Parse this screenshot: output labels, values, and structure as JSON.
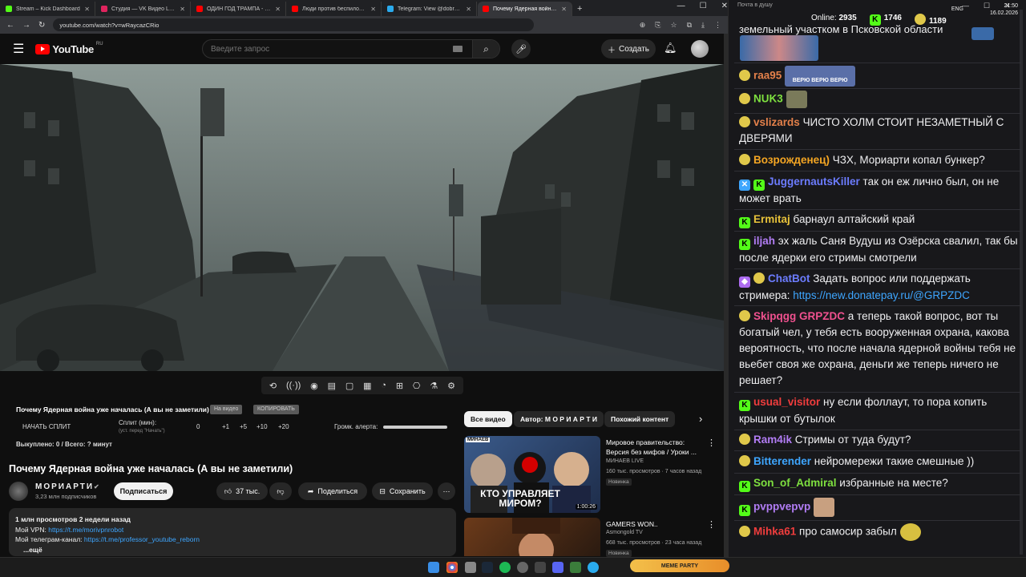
{
  "browser": {
    "tabs": [
      {
        "title": "Stream – Kick Dashboard",
        "color": "#53fc18",
        "active": false
      },
      {
        "title": "Студия — VK Видео Live",
        "color": "#e0245e",
        "active": false
      },
      {
        "title": "ОДИН ГОД ТРАМПА - YouTub...",
        "color": "#ff0000",
        "active": false
      },
      {
        "title": "Люди против беспилодни: сем...",
        "color": "#ff0000",
        "active": false
      },
      {
        "title": "Telegram: View @dobro_2ch",
        "color": "#2aabee",
        "active": false
      },
      {
        "title": "Почему Ядерная война у...",
        "color": "#ff0000",
        "active": true
      }
    ],
    "url": "youtube.com/watch?v=wRaycazCRio"
  },
  "youtube": {
    "logo_text": "YouTube",
    "region": "RU",
    "search_placeholder": "Введите запрос",
    "create_label": "Создать",
    "split_panel": {
      "title": "Почему Ядерная война уже началась (А вы не заметили)",
      "chip1": "На видео",
      "chip2": "КОПИРОВАТЬ",
      "start_split": "НАЧАТЬ СПЛИТ",
      "split_min": "Сплит (мин):",
      "split_hint": "(уст. перед \"Начать\")",
      "split_value": "0",
      "p1": "+1",
      "p5": "+5",
      "p10": "+10",
      "p20": "+20",
      "alert_label": "Громк. алерта:",
      "alert_volume": 1.0,
      "bought": "Выкуплено: 0 / Всего: ? минут"
    },
    "video_title": "Почему Ядерная война уже началась (А вы не заметили)",
    "channel": {
      "name": "МОРИАРТИ",
      "subs": "3,23 млн подписчиков",
      "subscribe": "Подписаться"
    },
    "actions": {
      "likes": "37 тыс.",
      "share": "Поделиться",
      "save": "Сохранить"
    },
    "description": {
      "stats": "1 млн просмотров  2 недели назад",
      "vpn_label": "Мой VPN: ",
      "vpn_link": "https://t.me/morivpnrobot",
      "tg_label": "Мой телеграм-канал: ",
      "tg_link": "https://t.me/professor_youtube_reborn",
      "more": "...ещё"
    },
    "rec_chips": [
      "Все видео",
      "Автор: М О Р И А Р Т И",
      "Похожий контент"
    ],
    "recommendations": [
      {
        "title": "Мировое правительство: Версия без мифов / Уроки ...",
        "channel": "МИНАЕВ LIVE",
        "meta": "160 тыс. просмотров · 7 часов назад",
        "badge": "Новинка",
        "thumb_text": "КТО УПРАВЛЯЕТ МИРОМ?",
        "thumb_tag": "МИНАЕВ",
        "duration": "1:00:26"
      },
      {
        "title": "GAMERS WON..",
        "channel": "Asmongold TV",
        "meta": "668 тыс. просмотров · 23 часа назад",
        "badge": "Новинка",
        "thumb_text": "",
        "thumb_tag": "",
        "duration": ""
      }
    ]
  },
  "chat": {
    "window_title": "Почта в душу",
    "online_label": "Online:",
    "online": "2935",
    "kick_count": "1746",
    "other_count": "1189",
    "top_text": "земельный участком в Псковской области",
    "messages": [
      {
        "user": "raa95",
        "color": "#e3804a",
        "text": "",
        "badges": [
          "p"
        ],
        "emote": "ВЕРЮ ВЕРЮ ВЕРЮ"
      },
      {
        "user": "NUK3",
        "color": "#7ee03f",
        "text": "",
        "badges": [
          "p"
        ]
      },
      {
        "user": "vslizards",
        "color": "#e3804a",
        "text": "ЧИСТО ХОЛМ СТОИТ НЕЗАМЕТНЫЙ С ДВЕРЯМИ",
        "badges": [
          "p"
        ]
      },
      {
        "user": "Возрожденец)",
        "color": "#f5a623",
        "text": "ЧЗХ, Мориарти копал бункер?",
        "badges": [
          "p"
        ]
      },
      {
        "user": "JuggernautsKiller",
        "color": "#6c7cff",
        "text": "так он еж лично был, он не может врать",
        "badges": [
          "b",
          "k"
        ]
      },
      {
        "user": "Ermitaj",
        "color": "#e8c23a",
        "text": "барнаул алтайский край",
        "badges": [
          "k"
        ]
      },
      {
        "user": "iljah",
        "color": "#b27df5",
        "text": "эх жаль Саня Вудуш из Озёрска свалил, так бы после ядерки его стримы смотрели",
        "badges": [
          "k"
        ]
      },
      {
        "user": "ChatBot",
        "color": "#6c7cff",
        "text": "Задать вопрос или поддержать стримера: ",
        "link": "https://new.donatepay.ru/@GRPZDC",
        "badges": [
          "c",
          "p"
        ]
      },
      {
        "user": "Skipqgg",
        "color": "#f0518f",
        "mention": "GRPZDC",
        "text": "а теперь такой вопрос, вот ты богатый чел, у тебя есть вооруженная охрана, какова вероятность, что после начала ядерной войны тебя не вьебет своя же охрана, деньги же теперь ничего не решает?",
        "badges": [
          "p"
        ]
      },
      {
        "user": "usual_visitor",
        "color": "#f03d3d",
        "text": "ну если фоллаут, то пора копить крышки от бутылок",
        "badges": [
          "k"
        ]
      },
      {
        "user": "Ram4ik",
        "color": "#b27df5",
        "text": "Стримы от туда будут?",
        "badges": [
          "p"
        ]
      },
      {
        "user": "Bitterender",
        "color": "#3ea6ff",
        "text": "нейромережи такие смешные ))",
        "badges": [
          "p"
        ]
      },
      {
        "user": "Son_of_Admiral",
        "color": "#7ee03f",
        "text": "избранные на месте?",
        "badges": [
          "k"
        ]
      },
      {
        "user": "pvppvepvp",
        "color": "#b27df5",
        "text": "",
        "badges": [
          "k"
        ]
      },
      {
        "user": "Mihka61",
        "color": "#f03d3d",
        "text": "про самосир забыл",
        "badges": [
          "p"
        ]
      }
    ]
  },
  "taskbar": {
    "lang": "ENG",
    "time": "21:50",
    "date": "16.02.2026",
    "meme": "MEME PARTY"
  }
}
